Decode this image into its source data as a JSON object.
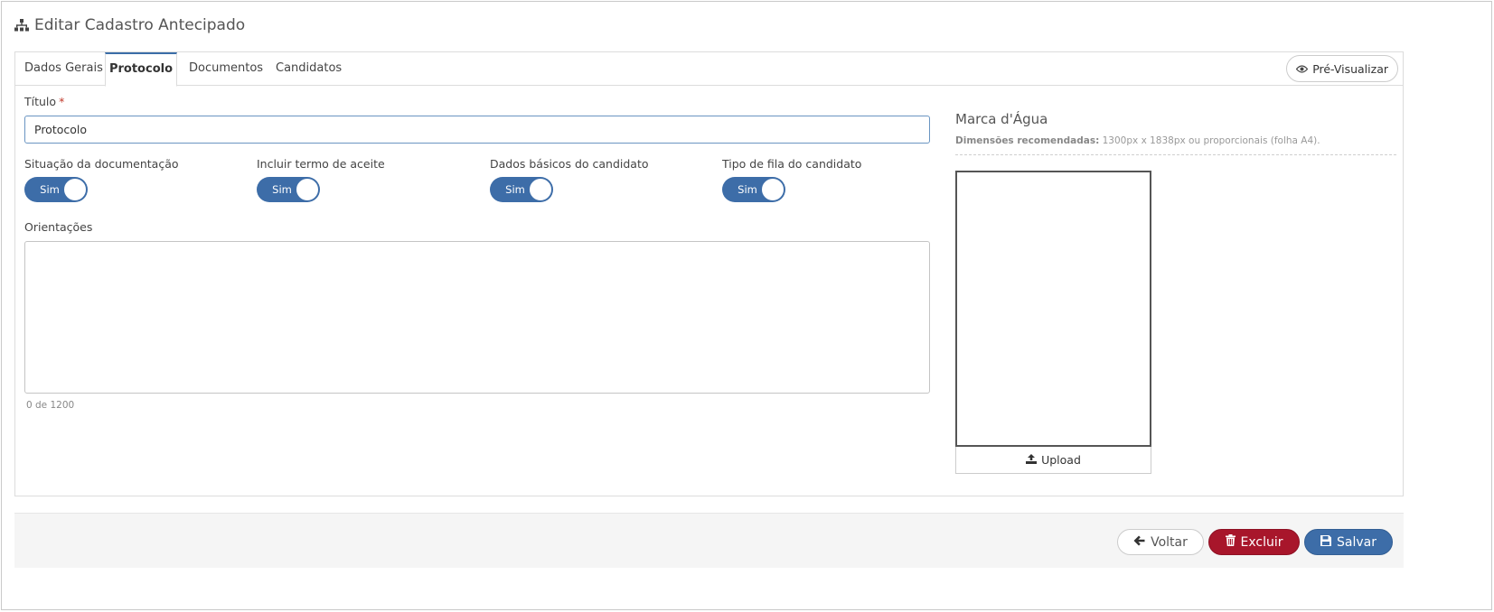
{
  "page": {
    "title": "Editar Cadastro Antecipado"
  },
  "tabs": [
    "Dados Gerais",
    "Protocolo",
    "Documentos",
    "Candidatos"
  ],
  "active_tab": "Protocolo",
  "preview_button": "Pré-Visualizar",
  "form": {
    "title_label": "Título",
    "title_required": "*",
    "title_value": "Protocolo",
    "toggles": [
      {
        "label": "Situação da documentação",
        "state": "Sim"
      },
      {
        "label": "Incluir termo de aceite",
        "state": "Sim"
      },
      {
        "label": "Dados básicos do candidato",
        "state": "Sim"
      },
      {
        "label": "Tipo de fila do candidato",
        "state": "Sim"
      }
    ],
    "orientations_label": "Orientações",
    "orientations_value": "",
    "counter": "0 de 1200"
  },
  "watermark": {
    "title": "Marca d'Água",
    "hint_label": "Dimensões recomendadas:",
    "hint_text": "1300px x 1838px ou proporcionais (folha A4).",
    "upload_label": "Upload"
  },
  "footer": {
    "back": "Voltar",
    "delete": "Excluir",
    "save": "Salvar"
  },
  "colors": {
    "primary": "#3d6da8",
    "danger": "#a8162b",
    "required": "#c0392b"
  },
  "icons": {
    "title": "sitemap-icon",
    "preview": "eye-icon",
    "upload": "upload-icon",
    "back": "arrow-left-icon",
    "delete": "trash-icon",
    "save": "floppy-disk-icon"
  }
}
